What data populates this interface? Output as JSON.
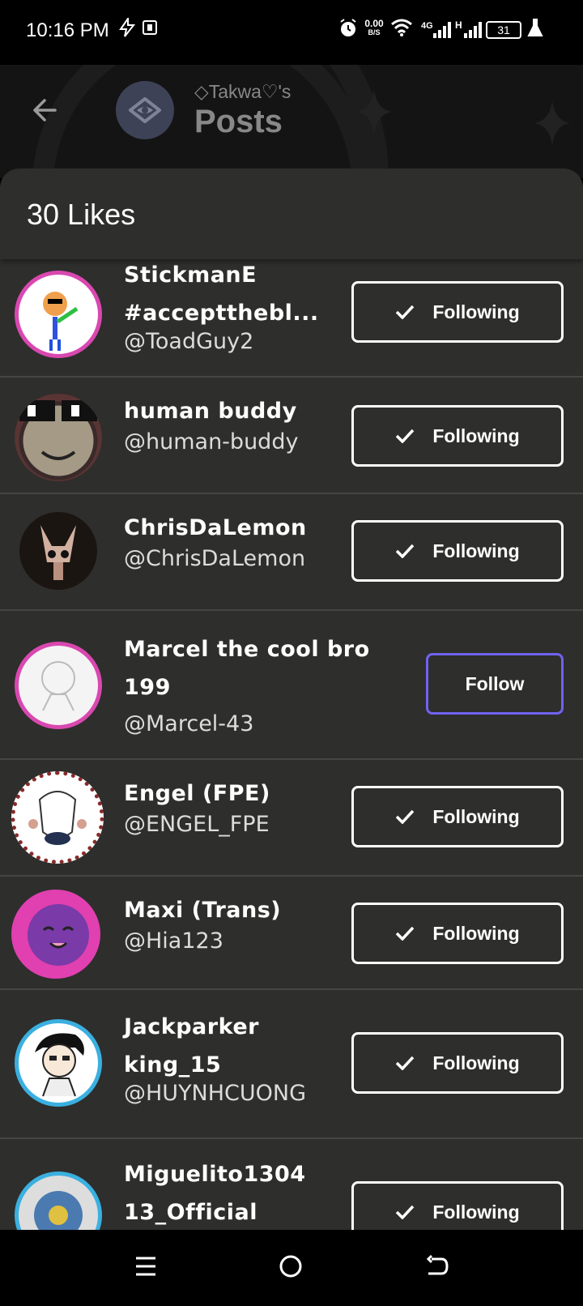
{
  "status_bar": {
    "time": "10:16 PM",
    "speed_value": "0.00",
    "speed_unit": "B/S",
    "network_4g": "4G",
    "network_h": "H",
    "battery": "31"
  },
  "header": {
    "subtitle": "◇Takwa♡'s",
    "title": "Posts"
  },
  "sheet": {
    "title": "30 Likes"
  },
  "users": [
    {
      "name": "StickmanE #acceptthebl...",
      "handle": "@ToadGuy2",
      "button": "Following"
    },
    {
      "name": "human buddy",
      "handle": "@human-buddy",
      "button": "Following"
    },
    {
      "name": "ChrisDaLemon",
      "handle": "@ChrisDaLemon",
      "button": "Following"
    },
    {
      "name": "Marcel the cool bro 199",
      "handle": "@Marcel-43",
      "button": "Follow"
    },
    {
      "name": "Engel (FPE)",
      "handle": "@ENGEL_FPE",
      "button": "Following"
    },
    {
      "name": "Maxi (Trans)",
      "handle": "@Hia123",
      "button": "Following"
    },
    {
      "name": "Jackparker king_15",
      "handle": "@HUYNHCUONG",
      "button": "Following"
    },
    {
      "name": "Miguelito1304 13_Official",
      "handle": "",
      "button": "Following"
    }
  ]
}
